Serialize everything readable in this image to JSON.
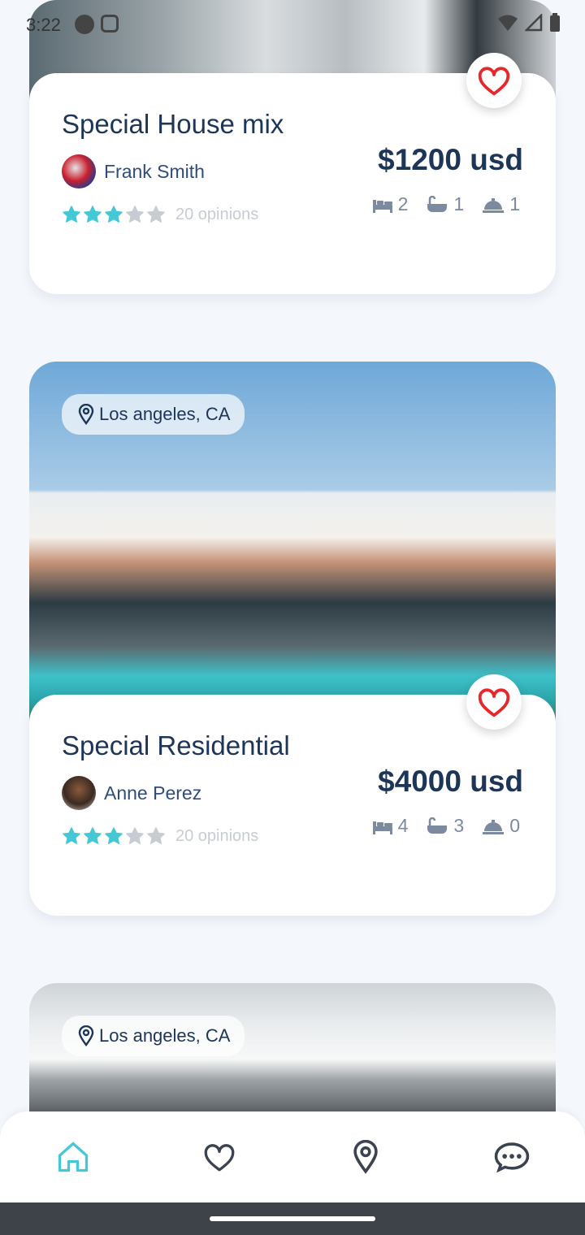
{
  "status_bar": {
    "time": "3:22"
  },
  "listings": [
    {
      "title": "Special House mix",
      "owner": "Frank Smith",
      "rating": 3,
      "opinions": "20 opinions",
      "price": "$1200 usd",
      "beds": "2",
      "baths": "1",
      "service": "1",
      "location": ""
    },
    {
      "title": "Special Residential",
      "owner": "Anne Perez",
      "rating": 3,
      "opinions": "20 opinions",
      "price": "$4000 usd",
      "beds": "4",
      "baths": "3",
      "service": "0",
      "location": "Los angeles, CA"
    },
    {
      "location": "Los angeles, CA"
    }
  ],
  "nav": [
    "home-icon",
    "heart-icon",
    "location-icon",
    "chat-icon"
  ],
  "colors": {
    "accent": "#45c8d6",
    "title": "#1d3557",
    "heart": "#e8262b"
  }
}
